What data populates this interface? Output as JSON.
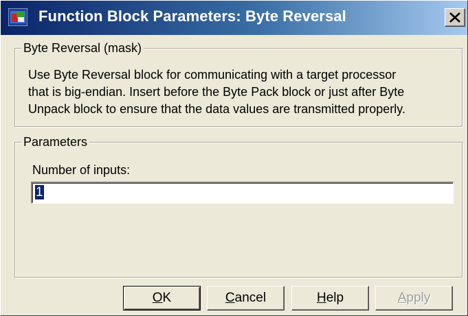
{
  "window": {
    "title": "Function Block Parameters: Byte Reversal",
    "icon": "simulink-block-icon",
    "close_symbol": "close-icon"
  },
  "mask_group": {
    "legend": "Byte Reversal (mask)",
    "description_lines": [
      "Use Byte Reversal block for communicating with a target processor",
      "that is big-endian. Insert before the Byte Pack block or just after Byte",
      "Unpack block to ensure that the data values are transmitted properly."
    ]
  },
  "parameters_group": {
    "legend": "Parameters",
    "inputs_label": "Number of inputs:",
    "inputs_value": "1"
  },
  "buttons": {
    "ok": {
      "mnemonic": "O",
      "rest": "K"
    },
    "cancel": {
      "mnemonic": "C",
      "rest": "ancel"
    },
    "help": {
      "mnemonic": "H",
      "rest": "elp"
    },
    "apply": {
      "mnemonic": "A",
      "rest": "pply"
    }
  },
  "colors": {
    "titlebar_start": "#0a246a",
    "titlebar_end": "#a6caf0",
    "face": "#ece9d8",
    "selection": "#0a246a"
  }
}
